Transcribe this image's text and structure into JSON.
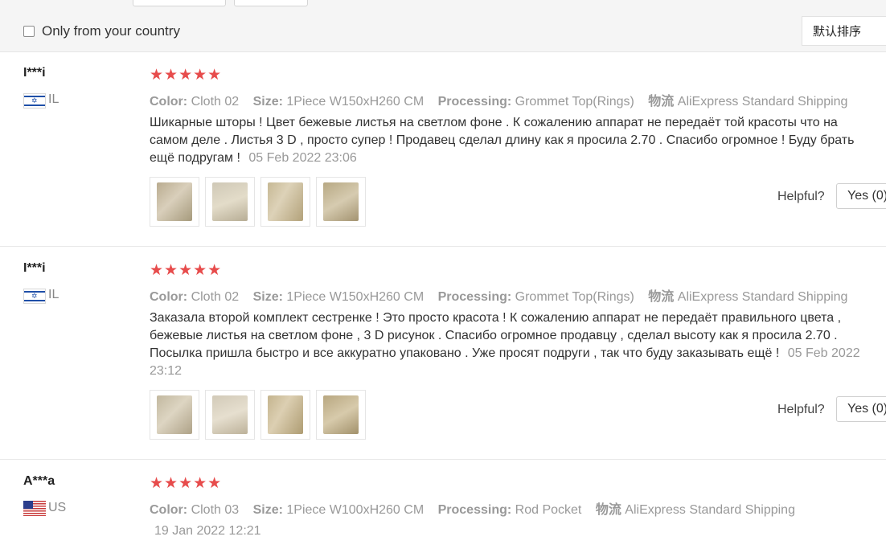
{
  "filter": {
    "only_country_label": "Only from your country"
  },
  "sort": {
    "selected": "默认排序"
  },
  "reviews": [
    {
      "user": "I***i",
      "country": "IL",
      "stars": "★★★★★",
      "color_label": "Color:",
      "color_value": "Cloth 02",
      "size_label": "Size:",
      "size_value": "1Piece W150xH260 CM",
      "processing_label": "Processing:",
      "processing_value": "Grommet Top(Rings)",
      "shipping_label": "物流",
      "shipping_value": "AliExpress Standard Shipping",
      "text": "Шикарные шторы ! Цвет бежевые листья на светлом фоне . К сожалению аппарат не передаёт той красоты что на самом деле . Листья 3 D , просто супер ! Продавец сделал длину как я просила 2.70 . Спасибо огромное ! Буду брать ещё подругам !",
      "date": "05 Feb 2022 23:06",
      "helpful_label": "Helpful?",
      "yes_label": "Yes (0)"
    },
    {
      "user": "I***i",
      "country": "IL",
      "stars": "★★★★★",
      "color_label": "Color:",
      "color_value": "Cloth 02",
      "size_label": "Size:",
      "size_value": "1Piece W150xH260 CM",
      "processing_label": "Processing:",
      "processing_value": "Grommet Top(Rings)",
      "shipping_label": "物流",
      "shipping_value": "AliExpress Standard Shipping",
      "text": "Заказала второй комплект сестренке ! Это просто красота ! К сожалению аппарат не передаёт правильного цвета , бежевые листья на светлом фоне , 3 D рисунок . Спасибо огромное продавцу , сделал высоту как я просила 2.70 . Посылка пришла быстро и все аккуратно упаковано . Уже просят подруги , так что буду заказывать ещё !",
      "date": "05 Feb 2022 23:12",
      "helpful_label": "Helpful?",
      "yes_label": "Yes (0)"
    },
    {
      "user": "A***a",
      "country": "US",
      "stars": "★★★★★",
      "color_label": "Color:",
      "color_value": "Cloth 03",
      "size_label": "Size:",
      "size_value": "1Piece W100xH260 CM",
      "processing_label": "Processing:",
      "processing_value": "Rod Pocket",
      "shipping_label": "物流",
      "shipping_value": "AliExpress Standard Shipping",
      "date": "19 Jan 2022 12:21"
    }
  ]
}
